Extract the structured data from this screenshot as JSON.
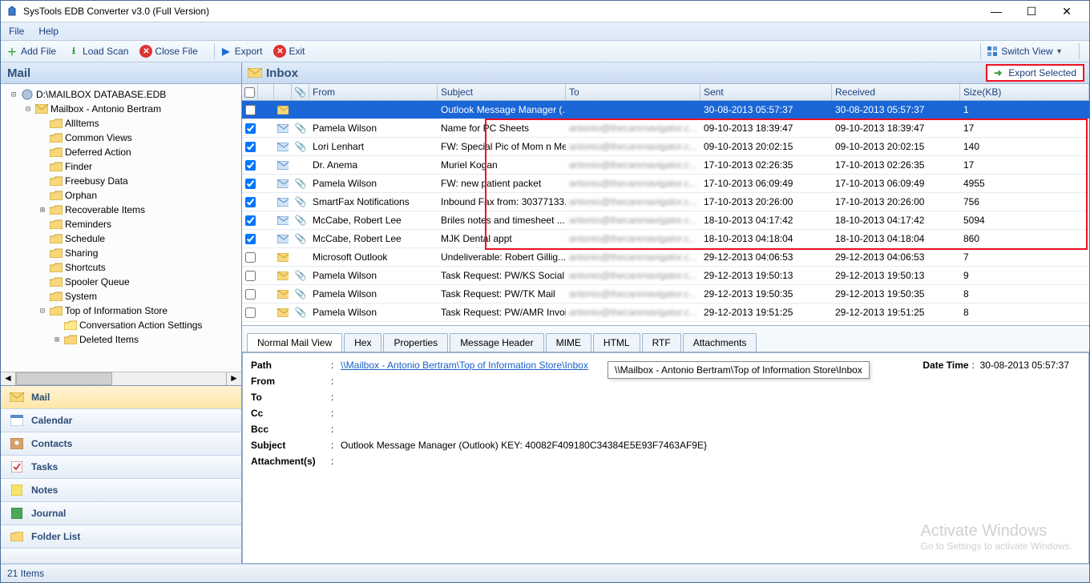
{
  "window": {
    "title": "SysTools EDB Converter v3.0 (Full Version)"
  },
  "menu": {
    "file": "File",
    "help": "Help"
  },
  "toolbar": {
    "add_file": "Add File",
    "load_scan": "Load Scan",
    "close_file": "Close File",
    "export": "Export",
    "exit": "Exit",
    "switch_view": "Switch View"
  },
  "sidebar": {
    "header": "Mail",
    "tree": [
      {
        "indent": 0,
        "tw": "-",
        "icon": "disk",
        "label": "D:\\MAILBOX DATABASE.EDB"
      },
      {
        "indent": 1,
        "tw": "-",
        "icon": "mbox",
        "label": "Mailbox - Antonio Bertram"
      },
      {
        "indent": 2,
        "tw": "",
        "icon": "fld",
        "label": "AllItems"
      },
      {
        "indent": 2,
        "tw": "",
        "icon": "fld",
        "label": "Common Views"
      },
      {
        "indent": 2,
        "tw": "",
        "icon": "fld",
        "label": "Deferred Action"
      },
      {
        "indent": 2,
        "tw": "",
        "icon": "fld",
        "label": "Finder"
      },
      {
        "indent": 2,
        "tw": "",
        "icon": "fld",
        "label": "Freebusy Data"
      },
      {
        "indent": 2,
        "tw": "",
        "icon": "fld",
        "label": "Orphan"
      },
      {
        "indent": 2,
        "tw": "+",
        "icon": "fld",
        "label": "Recoverable Items"
      },
      {
        "indent": 2,
        "tw": "",
        "icon": "fld",
        "label": "Reminders"
      },
      {
        "indent": 2,
        "tw": "",
        "icon": "fld",
        "label": "Schedule"
      },
      {
        "indent": 2,
        "tw": "",
        "icon": "fld",
        "label": "Sharing"
      },
      {
        "indent": 2,
        "tw": "",
        "icon": "fld",
        "label": "Shortcuts"
      },
      {
        "indent": 2,
        "tw": "",
        "icon": "fld",
        "label": "Spooler Queue"
      },
      {
        "indent": 2,
        "tw": "",
        "icon": "fld",
        "label": "System"
      },
      {
        "indent": 2,
        "tw": "-",
        "icon": "fld",
        "label": "Top of Information Store"
      },
      {
        "indent": 3,
        "tw": "",
        "icon": "fld-y",
        "label": "Conversation Action Settings"
      },
      {
        "indent": 3,
        "tw": "+",
        "icon": "fld",
        "label": "Deleted Items"
      }
    ],
    "nav": {
      "mail": "Mail",
      "calendar": "Calendar",
      "contacts": "Contacts",
      "tasks": "Tasks",
      "notes": "Notes",
      "journal": "Journal",
      "folder_list": "Folder List"
    }
  },
  "main": {
    "header": "Inbox",
    "export_selected": "Export Selected",
    "columns": {
      "from": "From",
      "subject": "Subject",
      "to": "To",
      "sent": "Sent",
      "received": "Received",
      "size": "Size(KB)"
    },
    "rows": [
      {
        "sel": true,
        "chk": false,
        "env": "y",
        "clip": false,
        "from": "",
        "subject": "Outlook Message Manager (...",
        "to": "",
        "sent": "30-08-2013 05:57:37",
        "recv": "30-08-2013 05:57:37",
        "size": "1"
      },
      {
        "chk": true,
        "env": "b",
        "clip": true,
        "from": "Pamela Wilson",
        "subject": "Name for PC Sheets",
        "to_blur": true,
        "sent": "09-10-2013 18:39:47",
        "recv": "09-10-2013 18:39:47",
        "size": "17"
      },
      {
        "chk": true,
        "env": "b",
        "clip": true,
        "from": "Lori Lenhart",
        "subject": "FW: Special Pic of Mom n Me",
        "to_blur": true,
        "sent": "09-10-2013 20:02:15",
        "recv": "09-10-2013 20:02:15",
        "size": "140"
      },
      {
        "chk": true,
        "env": "b",
        "clip": false,
        "from": "Dr. Anema",
        "subject": "Muriel Kogan",
        "to_blur": true,
        "sent": "17-10-2013 02:26:35",
        "recv": "17-10-2013 02:26:35",
        "size": "17"
      },
      {
        "chk": true,
        "env": "b",
        "clip": true,
        "from": "Pamela Wilson",
        "subject": "FW: new patient packet",
        "to_blur": true,
        "sent": "17-10-2013 06:09:49",
        "recv": "17-10-2013 06:09:49",
        "size": "4955"
      },
      {
        "chk": true,
        "env": "b",
        "clip": true,
        "from": "SmartFax Notifications",
        "subject": "Inbound Fax from: 30377133...",
        "to_blur": true,
        "sent": "17-10-2013 20:26:00",
        "recv": "17-10-2013 20:26:00",
        "size": "756"
      },
      {
        "chk": true,
        "env": "b",
        "clip": true,
        "from": "McCabe, Robert Lee",
        "subject": "Briles notes and timesheet ...",
        "to_blur": true,
        "sent": "18-10-2013 04:17:42",
        "recv": "18-10-2013 04:17:42",
        "size": "5094"
      },
      {
        "chk": true,
        "env": "b",
        "clip": true,
        "from": "McCabe, Robert Lee",
        "subject": "MJK Dental appt",
        "to_blur": true,
        "sent": "18-10-2013 04:18:04",
        "recv": "18-10-2013 04:18:04",
        "size": "860"
      },
      {
        "chk": false,
        "env": "y",
        "clip": false,
        "from": "Microsoft Outlook",
        "subject": "Undeliverable:  Robert Gillig...",
        "to_blur": true,
        "sent": "29-12-2013 04:06:53",
        "recv": "29-12-2013 04:06:53",
        "size": "7"
      },
      {
        "chk": false,
        "env": "y",
        "clip": true,
        "from": "Pamela Wilson",
        "subject": "Task Request: PW/KS Social ...",
        "to_blur": true,
        "sent": "29-12-2013 19:50:13",
        "recv": "29-12-2013 19:50:13",
        "size": "9"
      },
      {
        "chk": false,
        "env": "y",
        "clip": true,
        "from": "Pamela Wilson",
        "subject": "Task Request: PW/TK Mail",
        "to_blur": true,
        "sent": "29-12-2013 19:50:35",
        "recv": "29-12-2013 19:50:35",
        "size": "8"
      },
      {
        "chk": false,
        "env": "y",
        "clip": true,
        "from": "Pamela Wilson",
        "subject": "Task Request: PW/AMR Invoi...",
        "to_blur": true,
        "sent": "29-12-2013 19:51:25",
        "recv": "29-12-2013 19:51:25",
        "size": "8"
      }
    ],
    "detail_tabs": {
      "normal": "Normal Mail View",
      "hex": "Hex",
      "properties": "Properties",
      "header": "Message Header",
      "mime": "MIME",
      "html": "HTML",
      "rtf": "RTF",
      "attach": "Attachments"
    },
    "detail": {
      "path_label": "Path",
      "path_link": "\\\\Mailbox",
      "path_rest": " - Antonio Bertram\\Top of Information Store\\Inbox",
      "datetime_label": "Date Time",
      "datetime": "30-08-2013 05:57:37",
      "from_label": "From",
      "from": "",
      "to_label": "To",
      "to": "",
      "cc_label": "Cc",
      "cc": "",
      "bcc_label": "Bcc",
      "bcc": "",
      "subject_label": "Subject",
      "subject": "Outlook Message Manager (Outlook) KEY: 40082F409180C34384E5E93F7463AF9E}",
      "attach_label": "Attachment(s)",
      "attach": "",
      "tooltip": "\\\\Mailbox - Antonio Bertram\\Top of Information Store\\Inbox"
    }
  },
  "watermark": {
    "l1": "Activate Windows",
    "l2": "Go to Settings to activate Windows."
  },
  "status": {
    "items": "21 Items"
  }
}
